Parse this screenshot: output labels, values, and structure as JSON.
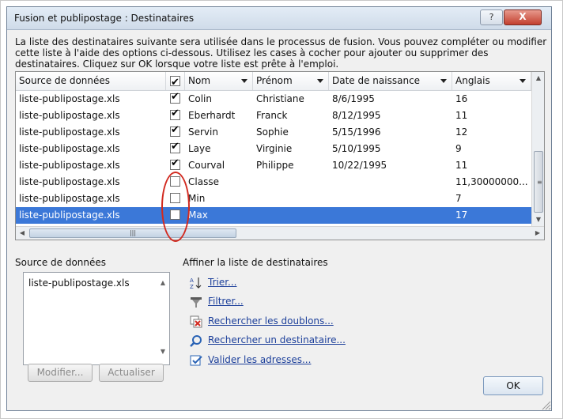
{
  "window": {
    "title": "Fusion et publipostage : Destinataires",
    "help_label": "?",
    "close_label": "X"
  },
  "intro_text": "La liste des destinataires suivante sera utilisée dans le processus de fusion. Vous pouvez compléter ou modifier cette liste à l'aide des options ci-dessous. Utilisez les cases à cocher pour ajouter ou supprimer des destinataires. Cliquez sur OK lorsque votre liste est prête à l'emploi.",
  "table": {
    "columns": [
      "Source de données",
      "",
      "Nom",
      "Prénom",
      "Date de naissance",
      "Anglais"
    ],
    "header_checked": true,
    "rows": [
      {
        "source": "liste-publipostage.xls",
        "checked": true,
        "nom": "Colin",
        "prenom": "Christiane",
        "date": "8/6/1995",
        "anglais": "16"
      },
      {
        "source": "liste-publipostage.xls",
        "checked": true,
        "nom": "Eberhardt",
        "prenom": "Franck",
        "date": "8/12/1995",
        "anglais": "11"
      },
      {
        "source": "liste-publipostage.xls",
        "checked": true,
        "nom": "Servin",
        "prenom": "Sophie",
        "date": "5/15/1996",
        "anglais": "12"
      },
      {
        "source": "liste-publipostage.xls",
        "checked": true,
        "nom": "Laye",
        "prenom": "Virginie",
        "date": "5/10/1995",
        "anglais": "9"
      },
      {
        "source": "liste-publipostage.xls",
        "checked": true,
        "nom": "Courval",
        "prenom": "Philippe",
        "date": "10/22/1995",
        "anglais": "11"
      },
      {
        "source": "liste-publipostage.xls",
        "checked": false,
        "nom": "Classe",
        "prenom": "",
        "date": "",
        "anglais": "11,30000000..."
      },
      {
        "source": "liste-publipostage.xls",
        "checked": false,
        "nom": "Min",
        "prenom": "",
        "date": "",
        "anglais": "7"
      },
      {
        "source": "liste-publipostage.xls",
        "checked": false,
        "nom": "Max",
        "prenom": "",
        "date": "",
        "anglais": "17",
        "selected": true
      }
    ]
  },
  "data_sources": {
    "label": "Source de données",
    "items": [
      "liste-publipostage.xls"
    ],
    "modify_label": "Modifier...",
    "refresh_label": "Actualiser"
  },
  "refine": {
    "label": "Affiner la liste de destinataires",
    "links": [
      {
        "label": "Trier...",
        "icon": "sort-az-icon"
      },
      {
        "label": "Filtrer...",
        "icon": "filter-icon"
      },
      {
        "label": "Rechercher les doublons...",
        "icon": "duplicates-icon"
      },
      {
        "label": "Rechercher un destinataire...",
        "icon": "find-recipient-icon"
      },
      {
        "label": "Valider les adresses...",
        "icon": "validate-addresses-icon"
      }
    ]
  },
  "ok_label": "OK"
}
